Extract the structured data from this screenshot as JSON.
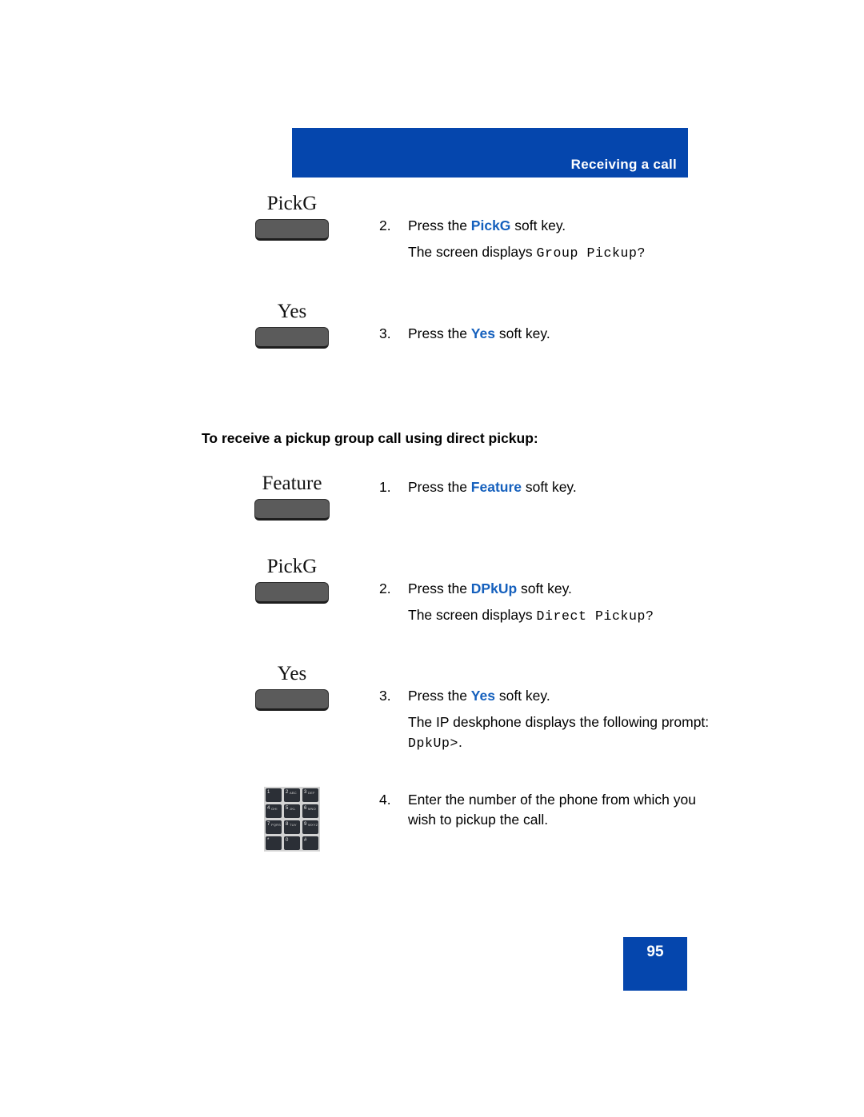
{
  "header": {
    "title": "Receiving a call",
    "banner_color": "#0546AD"
  },
  "colors": {
    "banner_blue": "#0546AD",
    "accent_blue": "#1560BD",
    "softkey_gray": "#5B5B5B"
  },
  "section_heading": "To receive a pickup group call using direct pickup:",
  "steps": [
    {
      "key_label": "PickG",
      "key_graphic": "softkey",
      "number": "2.",
      "text_before": "Press the ",
      "accent": "PickG",
      "text_after": " soft key.",
      "sub_before": "The screen displays ",
      "sub_mono": "Group Pickup?",
      "sub_after": ""
    },
    {
      "key_label": "Yes",
      "key_graphic": "softkey",
      "number": "3.",
      "text_before": "Press the ",
      "accent": "Yes",
      "text_after": " soft key.",
      "sub_before": "",
      "sub_mono": "",
      "sub_after": ""
    },
    {
      "key_label": "Feature",
      "key_graphic": "softkey",
      "number": "1.",
      "text_before": "Press the ",
      "accent": "Feature",
      "text_after": " soft key.",
      "sub_before": "",
      "sub_mono": "",
      "sub_after": ""
    },
    {
      "key_label": "PickG",
      "key_graphic": "softkey",
      "number": "2.",
      "text_before": "Press the ",
      "accent": "DPkUp",
      "text_after": " soft key.",
      "sub_before": "The screen displays ",
      "sub_mono": "Direct Pickup?",
      "sub_after": ""
    },
    {
      "key_label": "Yes",
      "key_graphic": "softkey",
      "number": "3.",
      "text_before": "Press the ",
      "accent": "Yes",
      "text_after": " soft key.",
      "sub_before": "The IP deskphone displays the following prompt: ",
      "sub_mono": "DpkUp>",
      "sub_after": "."
    },
    {
      "key_label": "",
      "key_graphic": "keypad",
      "number": "4.",
      "text_before": "Enter the number of the phone from which you wish to pickup the call.",
      "accent": "",
      "text_after": "",
      "sub_before": "",
      "sub_mono": "",
      "sub_after": ""
    }
  ],
  "keypad": {
    "keys": [
      {
        "digit": "1",
        "letters": ""
      },
      {
        "digit": "2",
        "letters": "ABC"
      },
      {
        "digit": "3",
        "letters": "DEF"
      },
      {
        "digit": "4",
        "letters": "GHI"
      },
      {
        "digit": "5",
        "letters": "JKL"
      },
      {
        "digit": "6",
        "letters": "MNO"
      },
      {
        "digit": "7",
        "letters": "PQRS"
      },
      {
        "digit": "8",
        "letters": "TUV"
      },
      {
        "digit": "9",
        "letters": "WXYZ"
      },
      {
        "digit": "*",
        "letters": ""
      },
      {
        "digit": "0",
        "letters": ""
      },
      {
        "digit": "#",
        "letters": ""
      }
    ]
  },
  "page_number": "95"
}
